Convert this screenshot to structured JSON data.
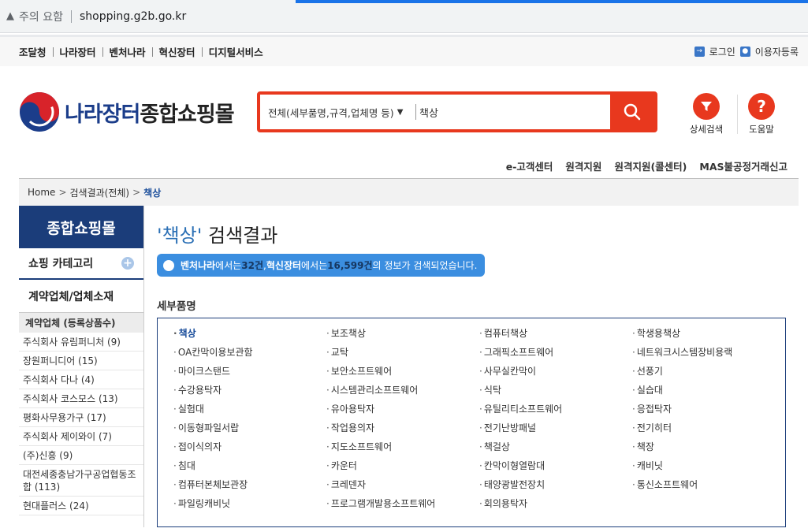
{
  "browser": {
    "warning": "주의 요함",
    "url": "shopping.g2b.go.kr"
  },
  "util": {
    "sites": [
      "조달청",
      "나라장터",
      "벤처나라",
      "혁신장터",
      "디지털서비스"
    ],
    "login": "로그인",
    "register": "이용자등록"
  },
  "header": {
    "logo_brand_a": "나라장터",
    "logo_brand_b": "종합쇼핑몰",
    "search_scope": "전체(세부품명,규격,업체명 등)",
    "search_value": "책상",
    "detail_search": "상세검색",
    "help": "도움말",
    "colors": {
      "accent": "#e8381e",
      "navy": "#1b3d7a"
    }
  },
  "subnav": [
    "e-고객센터",
    "원격지원",
    "원격지원(콜센터)",
    "MAS불공정거래신고"
  ],
  "breadcrumb": {
    "home": "Home",
    "mid": "검색결과(전체)",
    "current": "책상"
  },
  "sidebar": {
    "title": "종합쇼핑몰",
    "category": "쇼핑 카테고리",
    "vendor_section": "계약업체/업체소재",
    "vendor_head": "계약업체 (등록상품수)",
    "vendors": [
      "주식회사 유림퍼니처 (9)",
      "장원퍼니디어 (15)",
      "주식회사 다나 (4)",
      "주식회사 코스모스 (13)",
      "평화사무용가구 (17)",
      "주식회사 제이와이 (7)",
      "(주)신흥 (9)",
      "대전세종충남가구공업협동조합 (113)",
      "현대플러스 (24)"
    ]
  },
  "main": {
    "query": "'책상'",
    "title_suffix": " 검색결과",
    "info": {
      "venture": "벤처나라",
      "t1": "에서는 ",
      "venture_count": "32건",
      "t2": ", ",
      "innov": "혁신장터",
      "t3": "에서는 ",
      "innov_count": "16,599건",
      "t4": " 의 정보가 검색되었습니다."
    },
    "section": "세부품명",
    "items": [
      "책상",
      "보조책상",
      "컴퓨터책상",
      "학생용책상",
      "OA칸막이용보관함",
      "교탁",
      "그래픽소프트웨어",
      "네트워크시스템장비용랙",
      "마이크스탠드",
      "보안소프트웨어",
      "사무실칸막이",
      "선풍기",
      "수강용탁자",
      "시스템관리소프트웨어",
      "식탁",
      "실습대",
      "실험대",
      "유아용탁자",
      "유틸리티소프트웨어",
      "응접탁자",
      "이동형파일서랍",
      "작업용의자",
      "전기난방패널",
      "전기히터",
      "접이식의자",
      "지도소프트웨어",
      "책걸상",
      "책장",
      "침대",
      "카운터",
      "칸막이형열람대",
      "캐비닛",
      "컴퓨터본체보관장",
      "크레덴자",
      "태양광발전장치",
      "통신소프트웨어",
      "파일링캐비닛",
      "프로그램개발용소프트웨어",
      "회의용탁자"
    ]
  }
}
